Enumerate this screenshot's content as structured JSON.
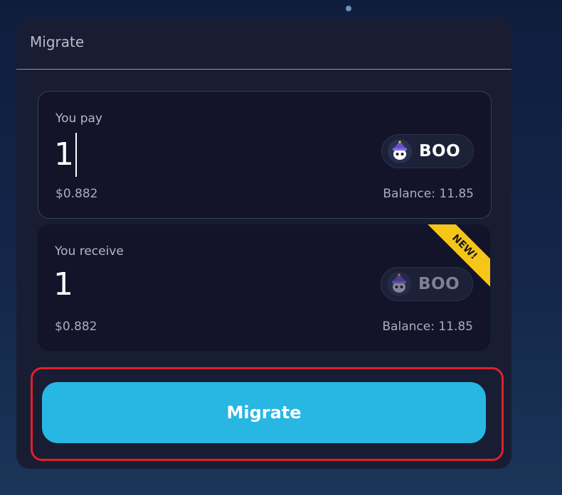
{
  "card": {
    "title": "Migrate"
  },
  "pay": {
    "label": "You pay",
    "amount": "1",
    "usd_value": "$0.882",
    "balance": "Balance: 11.85",
    "token": {
      "symbol": "BOO",
      "icon": "boo-ghost-icon"
    }
  },
  "receive": {
    "label": "You receive",
    "amount": "1",
    "usd_value": "$0.882",
    "balance": "Balance: 11.85",
    "badge": "NEW!",
    "token": {
      "symbol": "BOO",
      "icon": "boo-ghost-icon"
    }
  },
  "action": {
    "migrate_label": "Migrate"
  },
  "colors": {
    "accent": "#28b6e3",
    "badge": "#f5c518",
    "highlight": "#e0202c"
  }
}
